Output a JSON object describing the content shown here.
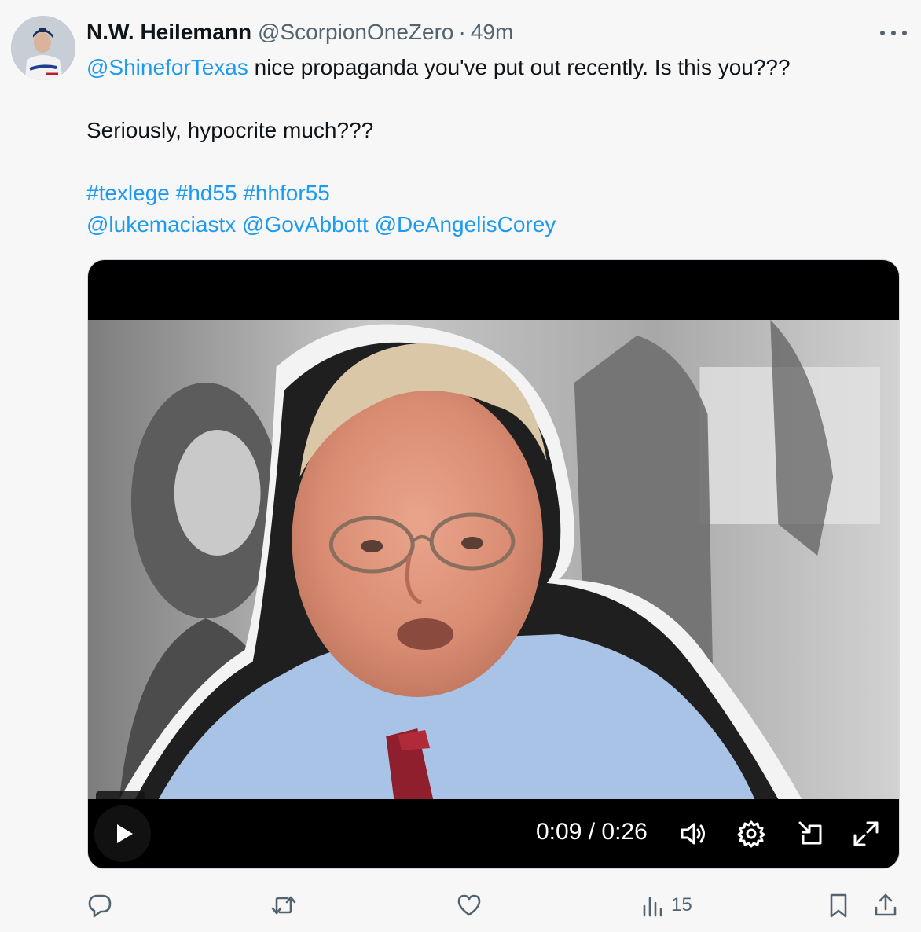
{
  "author": {
    "display_name": "N.W. Heilemann",
    "handle": "@ScorpionOneZero",
    "separator": "·",
    "time": "49m",
    "avatar_icon": "baseball-player-avatar"
  },
  "more_icon": "more-horizontal-icon",
  "post": {
    "mention_lead": "@ShineforTexas",
    "line1_text": " nice propaganda you've put out recently. Is this you???",
    "line2_text": "Seriously, hypocrite much???",
    "hashtags": [
      "#texlege",
      "#hd55",
      "#hhfor55"
    ],
    "mentions": [
      "@lukemaciastx",
      "@GovAbbott",
      "@DeAngelisCorey"
    ]
  },
  "video": {
    "tooltip": "Play",
    "current_time": "0:09",
    "time_separator": " / ",
    "duration": "0:26",
    "progress_fraction": 0.346,
    "icons": [
      "play-icon",
      "volume-icon",
      "settings-gear-icon",
      "picture-in-picture-icon",
      "fullscreen-expand-icon"
    ]
  },
  "actions": {
    "reply_icon": "reply-bubble-icon",
    "retweet_icon": "retweet-icon",
    "like_icon": "heart-icon",
    "views_icon": "views-bar-chart-icon",
    "views_count": "15",
    "bookmark_icon": "bookmark-icon",
    "share_icon": "share-upload-icon"
  },
  "colors": {
    "link": "#1d9bf0",
    "secondary_text": "#536471",
    "primary_text": "#0f1419"
  }
}
